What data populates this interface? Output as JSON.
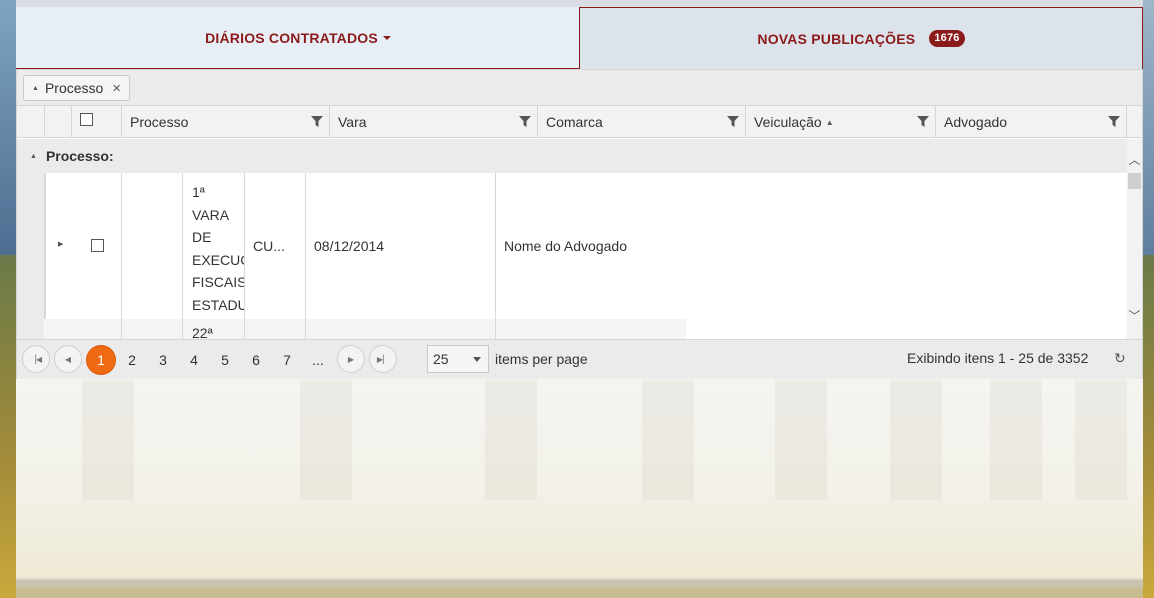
{
  "tabs": {
    "contracted": "DIÁRIOS CONTRATADOS",
    "new_publications": "NOVAS PUBLICAÇÕES",
    "new_count": "1676"
  },
  "grouping": {
    "chip_label": "Processo",
    "close_symbol": "×"
  },
  "columns": [
    "Processo",
    "Vara",
    "Comarca",
    "Veiculação",
    "Advogado"
  ],
  "sort_indicator": "▲",
  "group_row_label": "Processo:",
  "rows": [
    {
      "vara_lines": [
        "1ª",
        "VARA",
        "DE",
        "EXECUÇ",
        "FISCAIS",
        "ESTADU"
      ],
      "comarca": "CU...",
      "veiculacao": "08/12/2014",
      "advogado": "Nome do Advogado"
    },
    {
      "vara_lines": [
        "22ª"
      ],
      "comarca": "",
      "veiculacao": "",
      "advogado": ""
    }
  ],
  "pager": {
    "pages": [
      "1",
      "2",
      "3",
      "4",
      "5",
      "6",
      "7",
      "..."
    ],
    "active_page": "1",
    "page_size": "25",
    "page_size_label": "items per page",
    "info": "Exibindo itens 1 - 25 de 3352"
  },
  "colors": {
    "accent": "#8b1a1a",
    "active_page": "#ef6a12"
  }
}
